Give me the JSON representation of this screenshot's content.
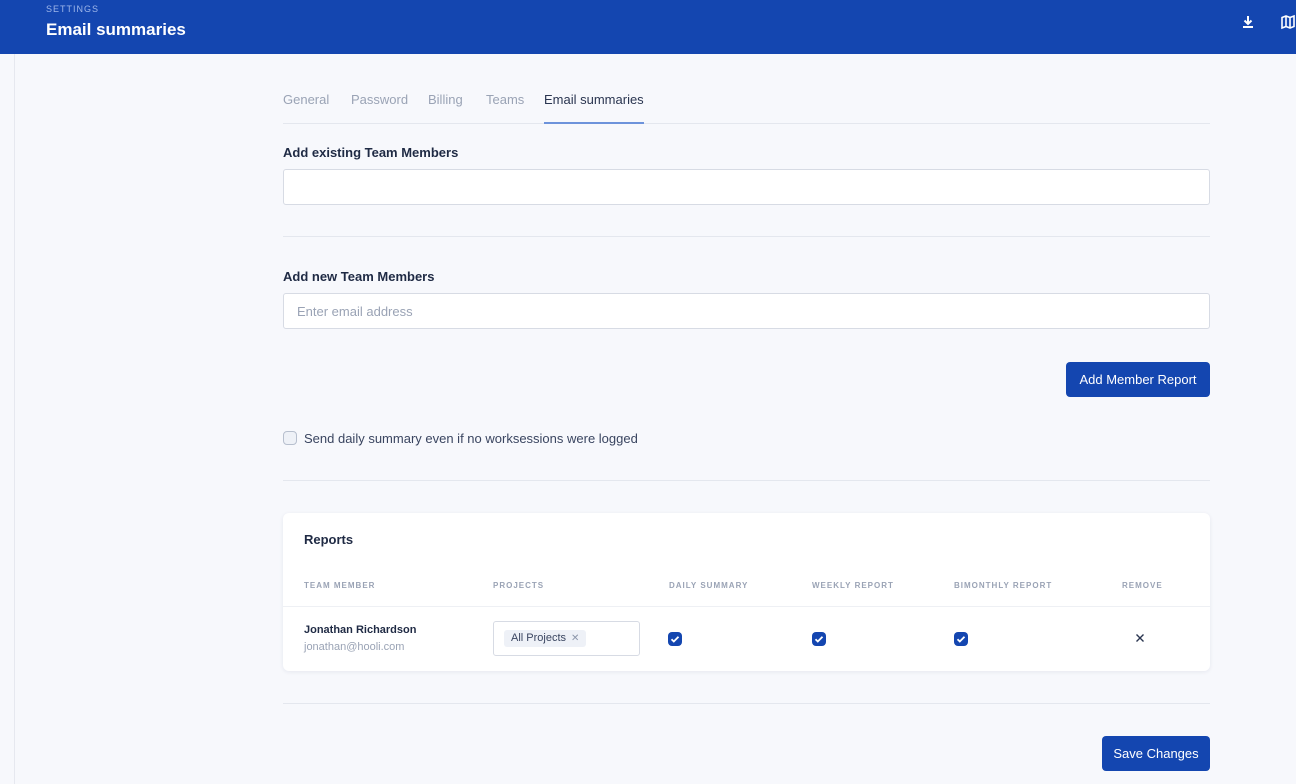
{
  "header": {
    "eyebrow": "SETTINGS",
    "title": "Email summaries",
    "icons": [
      "download-icon",
      "map-icon"
    ]
  },
  "tabs": [
    {
      "label": "General",
      "active": false
    },
    {
      "label": "Password",
      "active": false
    },
    {
      "label": "Billing",
      "active": false
    },
    {
      "label": "Teams",
      "active": false
    },
    {
      "label": "Email summaries",
      "active": true
    }
  ],
  "existing": {
    "label": "Add existing Team Members",
    "value": ""
  },
  "new_members": {
    "label": "Add new Team Members",
    "placeholder": "Enter email address",
    "value": ""
  },
  "add_button": "Add Member Report",
  "daily_option": {
    "label": "Send daily summary even if no worksessions were logged",
    "checked": false
  },
  "reports": {
    "title": "Reports",
    "columns": [
      "TEAM MEMBER",
      "PROJECTS",
      "DAILY SUMMARY",
      "WEEKLY REPORT",
      "BIMONTHLY REPORT",
      "REMOVE"
    ],
    "rows": [
      {
        "name": "Jonathan Richardson",
        "email": "jonathan@hooli.com",
        "projects": [
          "All Projects"
        ],
        "daily_summary": true,
        "weekly_report": true,
        "bimonthly_report": true
      }
    ]
  },
  "save_button": "Save Changes",
  "colors": {
    "brand": "#1446b0",
    "background": "#f7f8fc",
    "muted_text": "#9aa3b5"
  }
}
